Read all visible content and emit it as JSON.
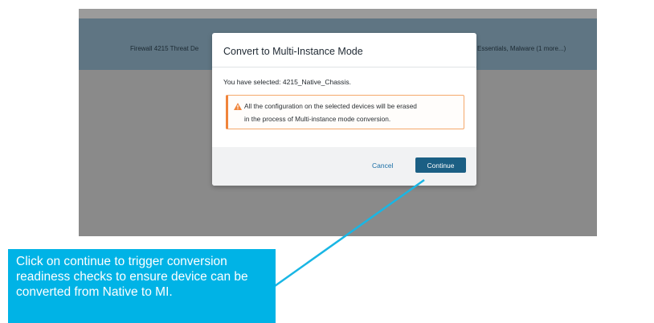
{
  "background_row": {
    "left_text": "Firewall 4215 Threat De",
    "right_text": "Essentials, Malware (1 more...)"
  },
  "dialog": {
    "title": "Convert to Multi-Instance Mode",
    "selected_text": "You have selected: 4215_Native_Chassis.",
    "warning": {
      "icon": "warning-triangle-icon",
      "line1": "All the configuration on the selected devices will be erased",
      "line2": "in the process of Multi-instance mode conversion."
    },
    "cancel_label": "Cancel",
    "continue_label": "Continue"
  },
  "callout": {
    "text": "Click on continue to trigger conversion readiness checks to ensure device can be converted from Native to MI."
  },
  "colors": {
    "primary_button": "#1b5f84",
    "warning_accent": "#f0843a",
    "callout": "#00b3e6",
    "pointer_line": "#19b6e4"
  }
}
